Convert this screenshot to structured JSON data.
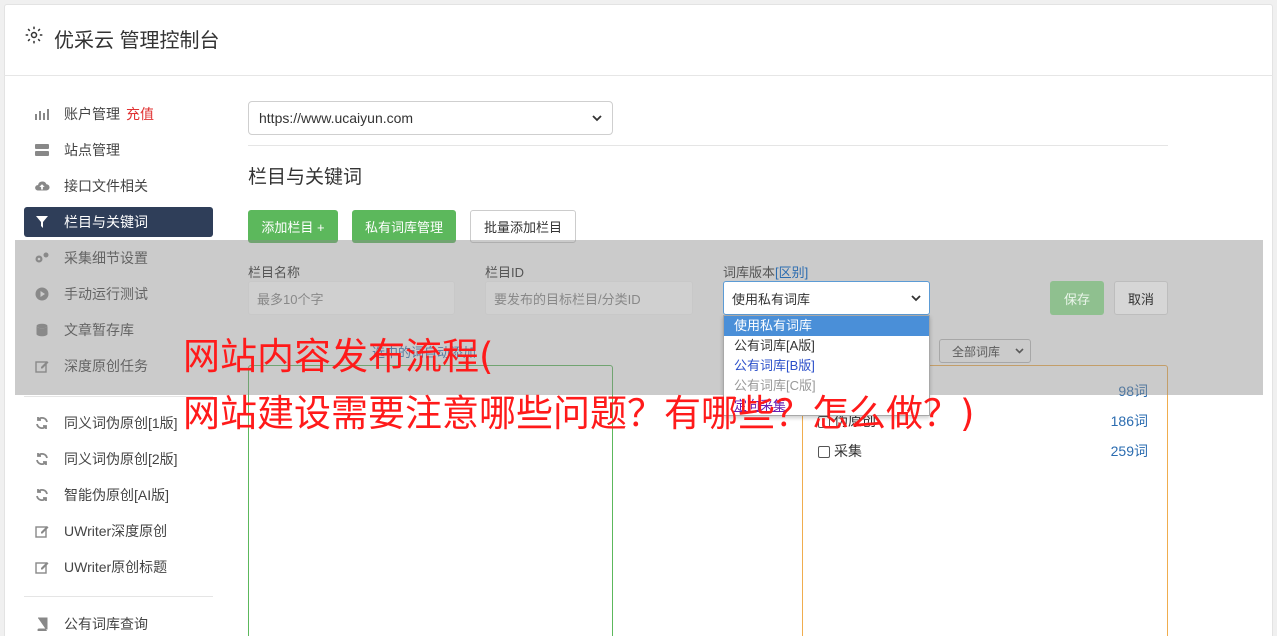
{
  "header": {
    "title": "优采云 管理控制台",
    "icon": "gear-icon"
  },
  "sidebar": {
    "items": [
      {
        "label": "账户管理",
        "extra": "充值",
        "icon": "bar-chart-icon"
      },
      {
        "label": "站点管理",
        "icon": "server-icon"
      },
      {
        "label": "接口文件相关",
        "icon": "cloud-upload-icon"
      },
      {
        "label": "栏目与关键词",
        "icon": "filter-icon",
        "active": true
      },
      {
        "label": "采集细节设置",
        "icon": "gears-icon"
      },
      {
        "label": "手动运行测试",
        "icon": "play-circle-icon"
      },
      {
        "label": "文章暂存库",
        "icon": "database-icon"
      },
      {
        "label": "深度原创任务",
        "icon": "edit-icon"
      },
      {
        "label": "同义词伪原创[1版]",
        "icon": "refresh-icon"
      },
      {
        "label": "同义词伪原创[2版]",
        "icon": "refresh-icon"
      },
      {
        "label": "智能伪原创[AI版]",
        "icon": "refresh-icon"
      },
      {
        "label": "UWriter深度原创",
        "icon": "edit-icon"
      },
      {
        "label": "UWriter原创标题",
        "icon": "edit-icon"
      },
      {
        "label": "公有词库查询",
        "icon": "book-icon"
      }
    ]
  },
  "main": {
    "site_select": "https://www.ucaiyun.com",
    "section_title": "栏目与关键词",
    "buttons": {
      "add_column": "添加栏目 +",
      "private_lib": "私有词库管理",
      "batch_add": "批量添加栏目"
    },
    "form": {
      "name_label": "栏目名称",
      "name_placeholder": "最多10个字",
      "id_label": "栏目ID",
      "id_placeholder": "要发布的目标栏目/分类ID",
      "version_label": "词库版本",
      "version_tag": "[区别]",
      "version_value": "使用私有词库",
      "save": "保存",
      "cancel": "取消"
    },
    "dropdown_options": [
      "使用私有词库",
      "公有词库[A版]",
      "公有词库[B版]",
      "公有词库[C版]",
      "定向采集"
    ],
    "panel_left_head": "选中的词自动添加",
    "lib_select": "全部词库",
    "libraries": [
      {
        "name": "",
        "count": "98词"
      },
      {
        "name": "伪原创",
        "count": "186词"
      },
      {
        "name": "采集",
        "count": "259词"
      }
    ]
  },
  "watermark": {
    "line1": "网站内容发布流程(",
    "line2": "网站建设需要注意哪些问题？有哪些？怎么做？)"
  },
  "colors": {
    "active_nav": "#2f3e59",
    "green": "#5cb85c",
    "accent_red": "#e03131"
  }
}
